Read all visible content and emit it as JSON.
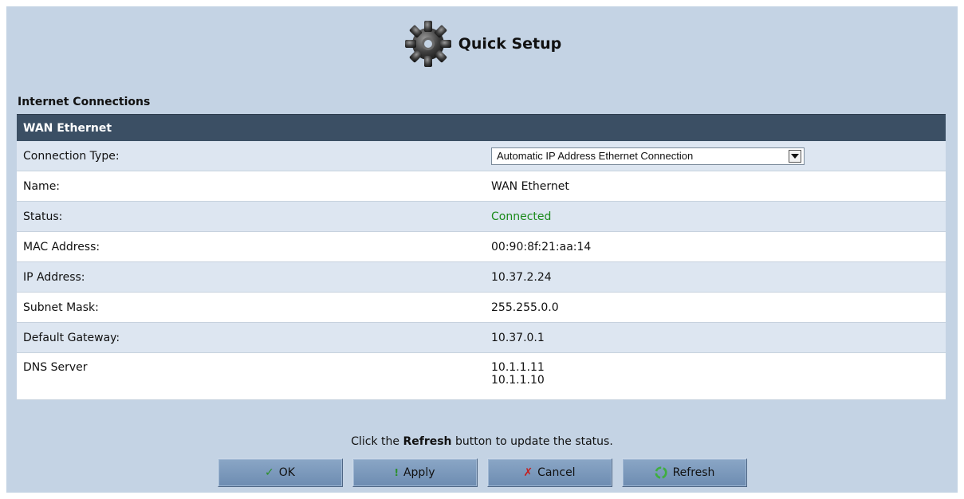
{
  "header": {
    "title": "Quick Setup",
    "icon": "gear-icon"
  },
  "section": {
    "title": "Internet Connections"
  },
  "table": {
    "header": "WAN Ethernet",
    "rows": [
      {
        "label": "Connection Type:",
        "select_value": "Automatic IP Address Ethernet Connection"
      },
      {
        "label": "Name:",
        "value": "WAN Ethernet"
      },
      {
        "label": "Status:",
        "value": "Connected"
      },
      {
        "label": "MAC Address:",
        "value": "00:90:8f:21:aa:14"
      },
      {
        "label": "IP Address:",
        "value": "10.37.2.24"
      },
      {
        "label": "Subnet Mask:",
        "value": "255.255.0.0"
      },
      {
        "label": "Default Gateway:",
        "value": "10.37.0.1"
      },
      {
        "label": "DNS Server",
        "values": [
          "10.1.1.11",
          "10.1.1.10"
        ]
      }
    ]
  },
  "hint": {
    "pre": "Click the ",
    "bold": "Refresh",
    "post": " button to update the status."
  },
  "buttons": {
    "ok": "OK",
    "apply": "Apply",
    "cancel": "Cancel",
    "refresh": "Refresh"
  },
  "colors": {
    "panel_bg": "#c4d3e4",
    "header_bg": "#3b4f64",
    "status_connected": "#1b8a1b"
  }
}
